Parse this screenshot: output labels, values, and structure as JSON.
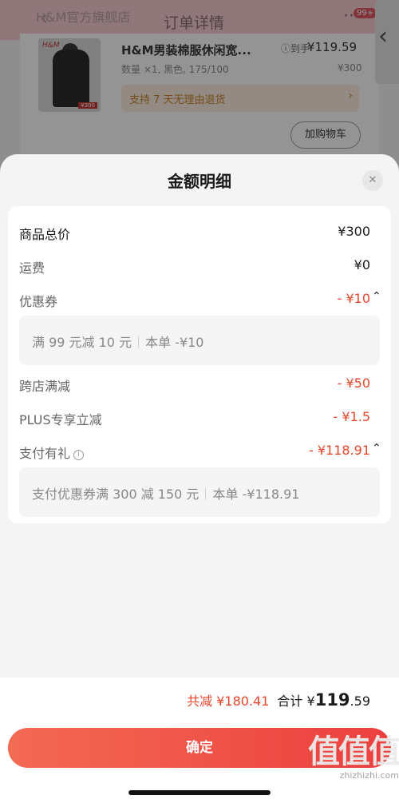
{
  "background": {
    "store_name": "H&M官方旗舰店",
    "page_title": "订单详情",
    "badge": "99+",
    "product": {
      "title": "H&M男装棉服休闲宽...",
      "spec": "数量 ×1, 黑色, 175/100",
      "info_label": "ⓘ到手",
      "final_price": "¥119.59",
      "original_price": "¥300",
      "thumb_logo": "H&M",
      "thumb_price": "¥300",
      "return_policy": "支持 7 天无理由退货",
      "add_to_cart": "加购物车"
    }
  },
  "sheet": {
    "title": "金额明细",
    "close_icon": "close-icon",
    "rows": [
      {
        "label": "商品总价",
        "value": "¥300"
      },
      {
        "label": "运费",
        "value": "¥0"
      },
      {
        "label": "优惠券",
        "value": "- ¥10"
      },
      {
        "label": "跨店满减",
        "value": "- ¥50"
      },
      {
        "label": "PLUS专享立减",
        "value": "- ¥1.5"
      },
      {
        "label": "支付有礼",
        "value": "- ¥118.91"
      }
    ],
    "coupon_detail": {
      "desc": "满 99 元减 10 元",
      "amount": "本单 -¥10"
    },
    "payment_detail": {
      "desc": "支付优惠券满 300 减 150 元",
      "amount": "本单 -¥118.91"
    }
  },
  "footer": {
    "savings": "共减 ¥180.41",
    "total_label": "合计",
    "total_currency": "¥",
    "total_int": "119",
    "total_dec": ".59",
    "confirm_label": "确定"
  },
  "watermark": {
    "big": "值值值",
    "small": "zhizhizhi.com"
  },
  "colors": {
    "accent": "#e8472c",
    "button": "#ec3f3f"
  }
}
